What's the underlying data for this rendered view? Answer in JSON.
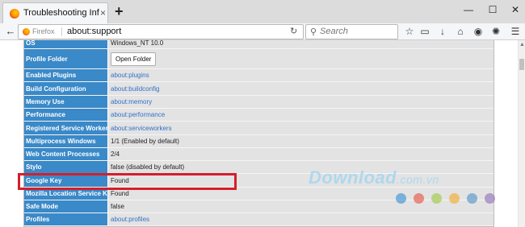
{
  "browser": {
    "tab_title": "Troubleshooting Information",
    "tab_close": "×",
    "new_tab": "+",
    "window_controls": [
      "—",
      "☐",
      "✕"
    ],
    "url_brand": "Firefox",
    "url": "about:support",
    "search_placeholder": "Search"
  },
  "table": {
    "rows": [
      {
        "label": "OS",
        "value": "Windows_NT 10.0",
        "kind": "text"
      },
      {
        "label": "Profile Folder",
        "value": "Open Folder",
        "kind": "button"
      },
      {
        "label": "Enabled Plugins",
        "value": "about:plugins",
        "kind": "link"
      },
      {
        "label": "Build Configuration",
        "value": "about:buildconfig",
        "kind": "link"
      },
      {
        "label": "Memory Use",
        "value": "about:memory",
        "kind": "link"
      },
      {
        "label": "Performance",
        "value": "about:performance",
        "kind": "link"
      },
      {
        "label": "Registered Service Workers",
        "value": "about:serviceworkers",
        "kind": "link"
      },
      {
        "label": "Multiprocess Windows",
        "value": "1/1 (Enabled by default)",
        "kind": "text"
      },
      {
        "label": "Web Content Processes",
        "value": "2/4",
        "kind": "text"
      },
      {
        "label": "Stylo",
        "value": "false (disabled by default)",
        "kind": "text"
      },
      {
        "label": "Google Key",
        "value": "Found",
        "kind": "text"
      },
      {
        "label": "Mozilla Location Service Key",
        "value": "Found",
        "kind": "text"
      },
      {
        "label": "Safe Mode",
        "value": "false",
        "kind": "text"
      },
      {
        "label": "Profiles",
        "value": "about:profiles",
        "kind": "link"
      }
    ]
  },
  "watermark": {
    "main": "Download",
    "tld": ".com.vn",
    "dot_colors": [
      "#2f8dd0",
      "#e84c3d",
      "#9bc83b",
      "#f5a623",
      "#4a90c9",
      "#8e6bb8"
    ]
  },
  "colors": {
    "header_cell": "#3a89c8",
    "value_cell": "#e3e3e3",
    "link": "#3470c8",
    "highlight": "#d31f2c"
  }
}
